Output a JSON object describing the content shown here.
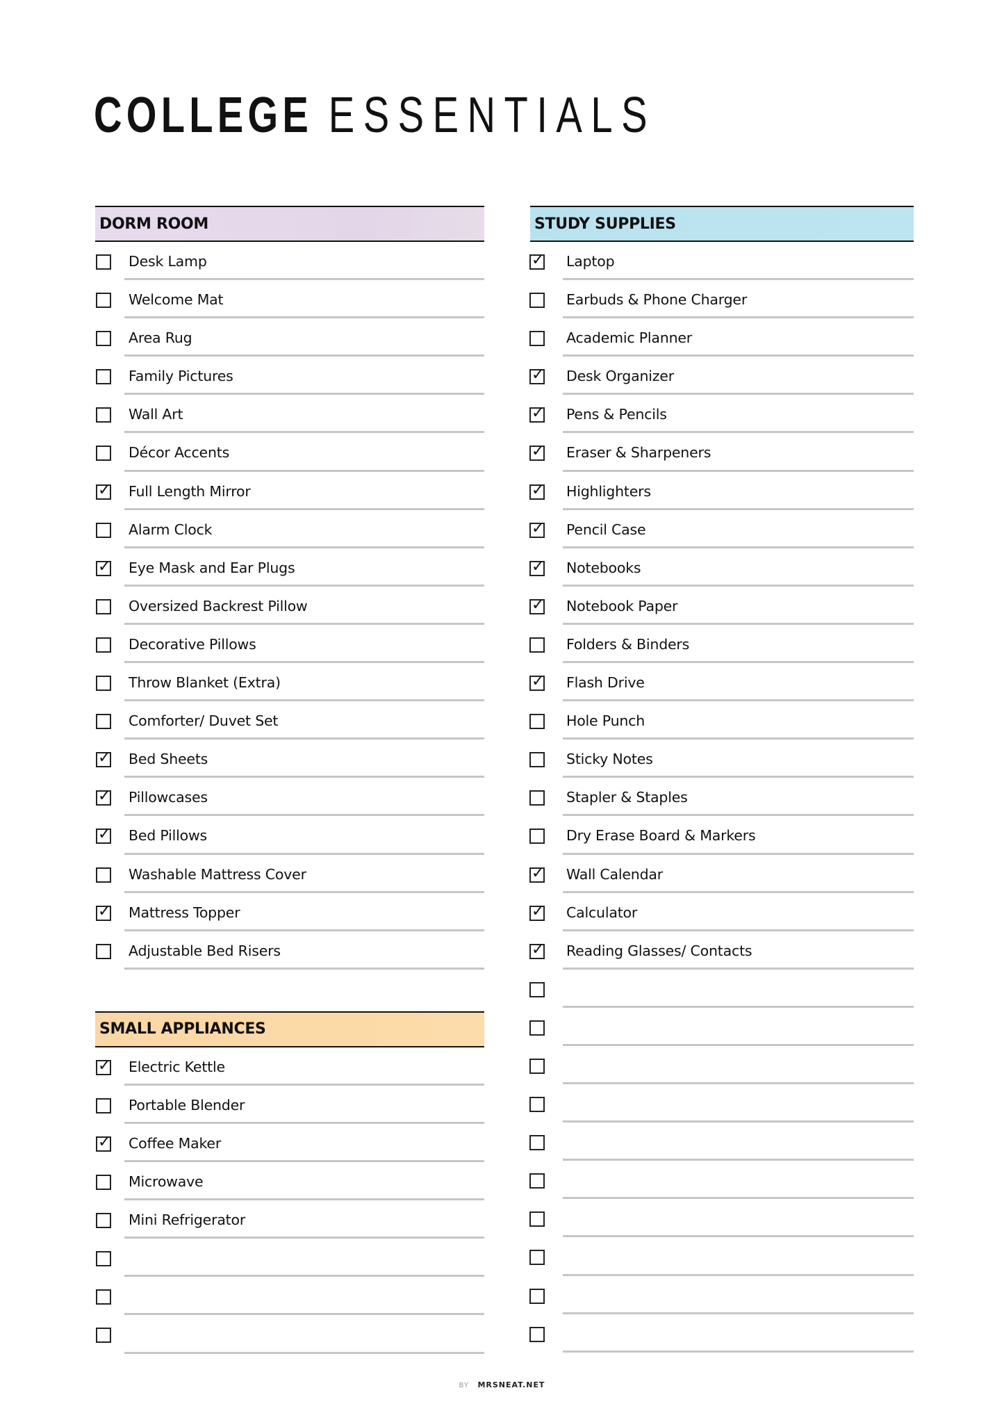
{
  "title": {
    "bold": "COLLEGE",
    "light": "ESSENTIALS"
  },
  "colors": {
    "dorm_header": "#e6d9ec",
    "study_header": "#bbe3f0",
    "appliances_header": "#fbd9a7",
    "rule": "#c6c6c6",
    "text": "#111111"
  },
  "sections": {
    "dorm": {
      "title": "DORM ROOM",
      "items": [
        {
          "label": "Desk Lamp",
          "checked": false
        },
        {
          "label": "Welcome Mat",
          "checked": false
        },
        {
          "label": "Area Rug",
          "checked": false
        },
        {
          "label": "Family Pictures",
          "checked": false
        },
        {
          "label": "Wall Art",
          "checked": false
        },
        {
          "label": "Décor Accents",
          "checked": false
        },
        {
          "label": "Full Length Mirror",
          "checked": true
        },
        {
          "label": "Alarm Clock",
          "checked": false
        },
        {
          "label": "Eye Mask and Ear Plugs",
          "checked": true
        },
        {
          "label": "Oversized Backrest Pillow",
          "checked": false
        },
        {
          "label": "Decorative Pillows",
          "checked": false
        },
        {
          "label": "Throw Blanket (Extra)",
          "checked": false
        },
        {
          "label": "Comforter/ Duvet Set",
          "checked": false
        },
        {
          "label": "Bed Sheets",
          "checked": true
        },
        {
          "label": "Pillowcases",
          "checked": true
        },
        {
          "label": "Bed Pillows",
          "checked": true
        },
        {
          "label": "Washable Mattress Cover",
          "checked": false
        },
        {
          "label": "Mattress Topper",
          "checked": true
        },
        {
          "label": "Adjustable Bed Risers",
          "checked": false
        }
      ]
    },
    "appliances": {
      "title": "SMALL APPLIANCES",
      "items": [
        {
          "label": "Electric Kettle",
          "checked": true
        },
        {
          "label": "Portable Blender",
          "checked": false
        },
        {
          "label": "Coffee Maker",
          "checked": true
        },
        {
          "label": "Microwave",
          "checked": false
        },
        {
          "label": "Mini Refrigerator",
          "checked": false
        },
        {
          "label": "",
          "checked": false
        },
        {
          "label": "",
          "checked": false
        },
        {
          "label": "",
          "checked": false
        }
      ]
    },
    "study": {
      "title": "STUDY SUPPLIES",
      "items": [
        {
          "label": "Laptop",
          "checked": true
        },
        {
          "label": "Earbuds & Phone Charger",
          "checked": false
        },
        {
          "label": "Academic Planner",
          "checked": false
        },
        {
          "label": "Desk Organizer",
          "checked": true
        },
        {
          "label": "Pens & Pencils",
          "checked": true
        },
        {
          "label": "Eraser & Sharpeners",
          "checked": true
        },
        {
          "label": "Highlighters",
          "checked": true
        },
        {
          "label": "Pencil Case",
          "checked": true
        },
        {
          "label": "Notebooks",
          "checked": true
        },
        {
          "label": "Notebook Paper",
          "checked": true
        },
        {
          "label": "Folders & Binders",
          "checked": false
        },
        {
          "label": "Flash Drive",
          "checked": true
        },
        {
          "label": "Hole Punch",
          "checked": false
        },
        {
          "label": "Sticky Notes",
          "checked": false
        },
        {
          "label": "Stapler & Staples",
          "checked": false
        },
        {
          "label": "Dry Erase Board & Markers",
          "checked": false
        },
        {
          "label": "Wall Calendar",
          "checked": true
        },
        {
          "label": "Calculator",
          "checked": true
        },
        {
          "label": "Reading Glasses/ Contacts",
          "checked": true
        },
        {
          "label": "",
          "checked": false
        },
        {
          "label": "",
          "checked": false
        },
        {
          "label": "",
          "checked": false
        },
        {
          "label": "",
          "checked": false
        },
        {
          "label": "",
          "checked": false
        },
        {
          "label": "",
          "checked": false
        },
        {
          "label": "",
          "checked": false
        },
        {
          "label": "",
          "checked": false
        },
        {
          "label": "",
          "checked": false
        },
        {
          "label": "",
          "checked": false
        }
      ]
    }
  },
  "footer": {
    "by": "BY",
    "site": "MRSNEAT.NET"
  },
  "icons": {
    "check": "✓"
  }
}
